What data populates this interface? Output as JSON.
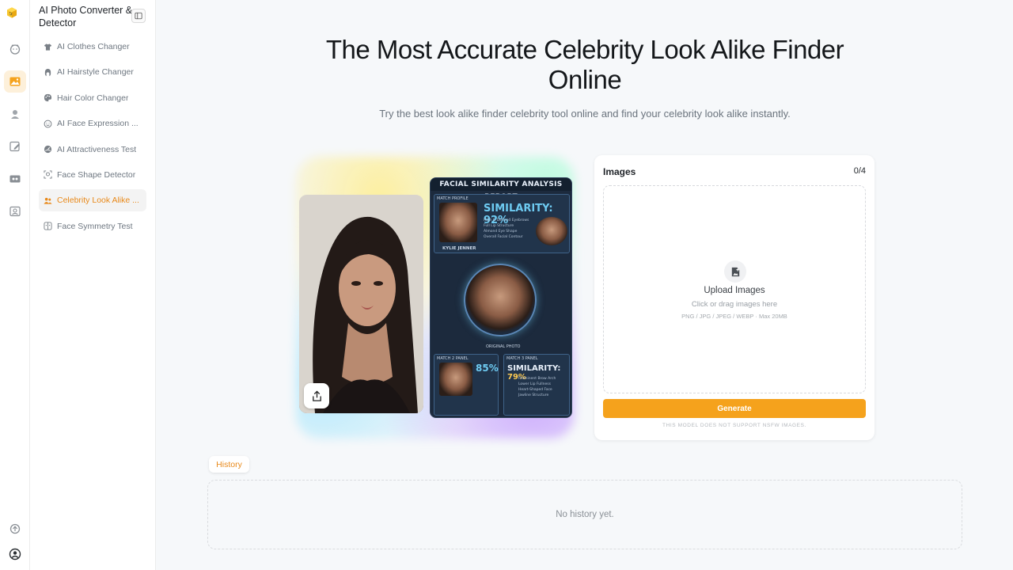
{
  "app": {
    "title": "AI Photo Converter & Detector"
  },
  "rail": {
    "items": [
      "home-icon",
      "image-icon",
      "user-icon",
      "edit-icon",
      "video-icon",
      "photo-edit-icon"
    ],
    "active_index": 1,
    "bottom": [
      "sync-icon",
      "account-icon"
    ]
  },
  "sidebar": {
    "items": [
      {
        "label": "AI Clothes Changer",
        "icon": "shirt-icon"
      },
      {
        "label": "AI Hairstyle Changer",
        "icon": "hair-icon"
      },
      {
        "label": "Hair Color Changer",
        "icon": "palette-icon"
      },
      {
        "label": "AI Face Expression ...",
        "icon": "smile-icon"
      },
      {
        "label": "AI Attractiveness Test",
        "icon": "gauge-icon"
      },
      {
        "label": "Face Shape Detector",
        "icon": "face-scan-icon"
      },
      {
        "label": "Celebrity Look Alike ...",
        "icon": "people-icon"
      },
      {
        "label": "Face Symmetry Test",
        "icon": "symmetry-icon"
      }
    ],
    "active_index": 6
  },
  "hero": {
    "title": "The Most Accurate Celebrity Look Alike Finder Online",
    "subtitle": "Try the best look alike finder celebrity tool online and find your celebrity look alike instantly."
  },
  "report": {
    "title": "FACIAL SIMILARITY ANALYSIS REPORT",
    "match_profile": "MATCH PROFILE",
    "similarity": "SIMILARITY: 92%",
    "celebrity": "KYLIE JENNER",
    "features": [
      "High & Defined Eyebrows",
      "Full Lip Structure",
      "Almond Eye Shape",
      "Overall Facial Contour"
    ],
    "original": "ORIGINAL PHOTO",
    "match2": "MATCH 2 PANEL",
    "match2_pct": "85%",
    "match3": "MATCH 3 PANEL",
    "match3_label": "SIMILARITY:",
    "match3_pct": "79%",
    "match3_features": [
      "Prominent Brow Arch",
      "Lower Lip Fullness",
      "Heart-Shaped Face",
      "Jawline Structure"
    ]
  },
  "upload": {
    "title": "Images",
    "count": "0/4",
    "dz_title": "Upload Images",
    "dz_hint": "Click or drag images here",
    "dz_formats": "PNG / JPG / JPEG / WEBP · Max 20MB",
    "generate": "Generate",
    "notice": "THIS MODEL DOES NOT SUPPORT NSFW IMAGES."
  },
  "history": {
    "tab": "History",
    "empty": "No history yet."
  },
  "colors": {
    "accent": "#f5a21c",
    "accent_text": "#e8891a"
  }
}
